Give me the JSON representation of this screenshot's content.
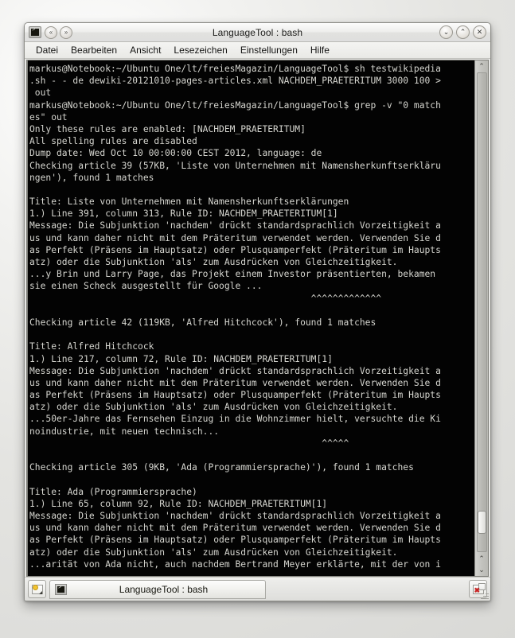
{
  "window": {
    "title": "LanguageTool : bash",
    "app_icon": "terminal-icon",
    "shade_up_icon": "«",
    "shade_down_icon": "»",
    "buttons": {
      "minimize": "⌄",
      "maximize": "⌃",
      "close": "✕"
    }
  },
  "menubar": {
    "items": [
      {
        "label": "Datei"
      },
      {
        "label": "Bearbeiten"
      },
      {
        "label": "Ansicht"
      },
      {
        "label": "Lesezeichen"
      },
      {
        "label": "Einstellungen"
      },
      {
        "label": "Hilfe"
      }
    ]
  },
  "terminal": {
    "foreground_color": "#d6d6d0",
    "background_color": "#030303",
    "lines": [
      "markus@Notebook:~/Ubuntu One/lt/freiesMagazin/LanguageTool$ sh testwikipedia",
      ".sh - - de dewiki-20121010-pages-articles.xml NACHDEM_PRAETERITUM 3000 100 >",
      " out",
      "markus@Notebook:~/Ubuntu One/lt/freiesMagazin/LanguageTool$ grep -v \"0 match",
      "es\" out",
      "Only these rules are enabled: [NACHDEM_PRAETERITUM]",
      "All spelling rules are disabled",
      "Dump date: Wed Oct 10 00:00:00 CEST 2012, language: de",
      "Checking article 39 (57KB, 'Liste von Unternehmen mit Namensherkunftserkläru",
      "ngen'), found 1 matches",
      "",
      "Title: Liste von Unternehmen mit Namensherkunftserklärungen",
      "1.) Line 391, column 313, Rule ID: NACHDEM_PRAETERITUM[1]",
      "Message: Die Subjunktion 'nachdem' drückt standardsprachlich Vorzeitigkeit a",
      "us und kann daher nicht mit dem Präteritum verwendet werden. Verwenden Sie d",
      "as Perfekt (Präsens im Hauptsatz) oder Plusquamperfekt (Präteritum im Haupts",
      "atz) oder die Subjunktion 'als' zum Ausdrücken von Gleichzeitigkeit.",
      "...y Brin und Larry Page, das Projekt einem Investor präsentierten, bekamen",
      "sie einen Scheck ausgestellt für Google ...",
      "                                                    ^^^^^^^^^^^^^",
      "",
      "Checking article 42 (119KB, 'Alfred Hitchcock'), found 1 matches",
      "",
      "Title: Alfred Hitchcock",
      "1.) Line 217, column 72, Rule ID: NACHDEM_PRAETERITUM[1]",
      "Message: Die Subjunktion 'nachdem' drückt standardsprachlich Vorzeitigkeit a",
      "us und kann daher nicht mit dem Präteritum verwendet werden. Verwenden Sie d",
      "as Perfekt (Präsens im Hauptsatz) oder Plusquamperfekt (Präteritum im Haupts",
      "atz) oder die Subjunktion 'als' zum Ausdrücken von Gleichzeitigkeit.",
      "...50er-Jahre das Fernsehen Einzug in die Wohnzimmer hielt, versuchte die Ki",
      "noindustrie, mit neuen technisch...",
      "                                                      ^^^^^",
      "",
      "Checking article 305 (9KB, 'Ada (Programmiersprache)'), found 1 matches",
      "",
      "Title: Ada (Programmiersprache)",
      "1.) Line 65, column 92, Rule ID: NACHDEM_PRAETERITUM[1]",
      "Message: Die Subjunktion 'nachdem' drückt standardsprachlich Vorzeitigkeit a",
      "us und kann daher nicht mit dem Präteritum verwendet werden. Verwenden Sie d",
      "as Perfekt (Präsens im Hauptsatz) oder Plusquamperfekt (Präteritum im Haupts",
      "atz) oder die Subjunktion 'als' zum Ausdrücken von Gleichzeitigkeit.",
      "...arität von Ada nicht, auch nachdem Bertrand Meyer erklärte, mit der von i"
    ]
  },
  "scrollbar": {
    "up_arrow": "⌃",
    "down_arrow": "⌄",
    "thumb_position": "near-bottom"
  },
  "tabbar": {
    "new_tab_icon": "new-tab-icon",
    "tab_label": "LanguageTool : bash",
    "tab_icon": "terminal-icon",
    "close_tab_icon": "close-tab-icon"
  }
}
